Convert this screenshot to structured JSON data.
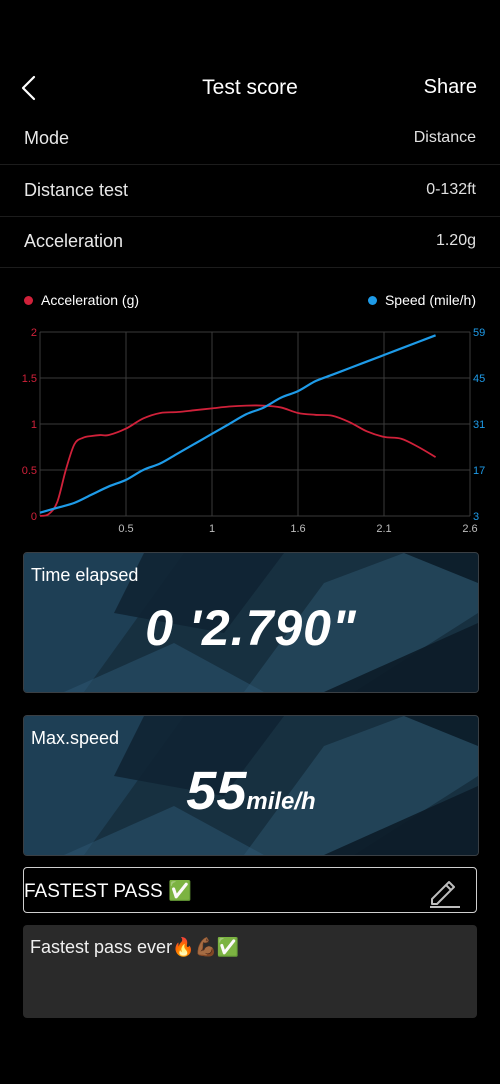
{
  "header": {
    "title": "Test score",
    "share_label": "Share"
  },
  "rows": [
    {
      "label": "Mode",
      "value": "Distance"
    },
    {
      "label": "Distance test",
      "value": "0-132ft"
    },
    {
      "label": "Acceleration",
      "value": "1.20g"
    }
  ],
  "legend": {
    "accel": {
      "label": "Acceleration (g)",
      "color": "#d0213a"
    },
    "speed": {
      "label": "Speed (mile/h)",
      "color": "#1e9be8"
    }
  },
  "chart_data": {
    "type": "line",
    "x_ticks": [
      "0.5",
      "1",
      "1.6",
      "2.1",
      "2.6"
    ],
    "x_tick_values": [
      0.5,
      1.0,
      1.5,
      2.0,
      2.5
    ],
    "xlim": [
      0,
      2.5
    ],
    "y_left_ticks": [
      "0",
      "0.5",
      "1",
      "1.5",
      "2"
    ],
    "y_left_lim": [
      0,
      2
    ],
    "y_right_ticks": [
      "3",
      "17",
      "31",
      "45",
      "59"
    ],
    "y_right_lim": [
      3,
      59
    ],
    "series": [
      {
        "name": "Acceleration (g)",
        "axis": "left",
        "x": [
          0,
          0.05,
          0.1,
          0.15,
          0.2,
          0.25,
          0.3,
          0.35,
          0.4,
          0.5,
          0.6,
          0.7,
          0.8,
          0.9,
          1.0,
          1.1,
          1.2,
          1.3,
          1.4,
          1.5,
          1.6,
          1.7,
          1.8,
          1.9,
          2.0,
          2.1,
          2.2,
          2.3
        ],
        "y": [
          0,
          0.02,
          0.15,
          0.5,
          0.78,
          0.85,
          0.87,
          0.88,
          0.88,
          0.95,
          1.06,
          1.12,
          1.13,
          1.15,
          1.17,
          1.19,
          1.2,
          1.2,
          1.18,
          1.12,
          1.1,
          1.09,
          1.02,
          0.92,
          0.86,
          0.84,
          0.75,
          0.64
        ]
      },
      {
        "name": "Speed (mile/h)",
        "axis": "right",
        "x": [
          0,
          0.1,
          0.2,
          0.3,
          0.4,
          0.5,
          0.6,
          0.7,
          0.8,
          0.9,
          1.0,
          1.1,
          1.2,
          1.3,
          1.4,
          1.5,
          1.6,
          1.7,
          1.8,
          1.9,
          2.0,
          2.1,
          2.2,
          2.3
        ],
        "y": [
          4,
          5.5,
          7,
          9.5,
          12,
          14,
          17,
          19,
          22,
          25,
          28,
          31,
          34,
          36,
          39,
          41,
          44,
          46,
          48,
          50,
          52,
          54,
          56,
          58
        ]
      }
    ]
  },
  "cards": {
    "time": {
      "label": "Time elapsed",
      "value": "0 '2.790\""
    },
    "speed": {
      "label": "Max.speed",
      "value": "55",
      "unit": "mile/h"
    }
  },
  "tag": {
    "text": "FASTEST PASS ✅"
  },
  "note": {
    "text": "Fastest pass ever🔥💪🏾✅"
  },
  "colors": {
    "grid": "#3a3a3a",
    "card_bg": "#1b3344"
  },
  "icons": {
    "back": "chevron-left-icon",
    "edit": "pencil-icon"
  }
}
